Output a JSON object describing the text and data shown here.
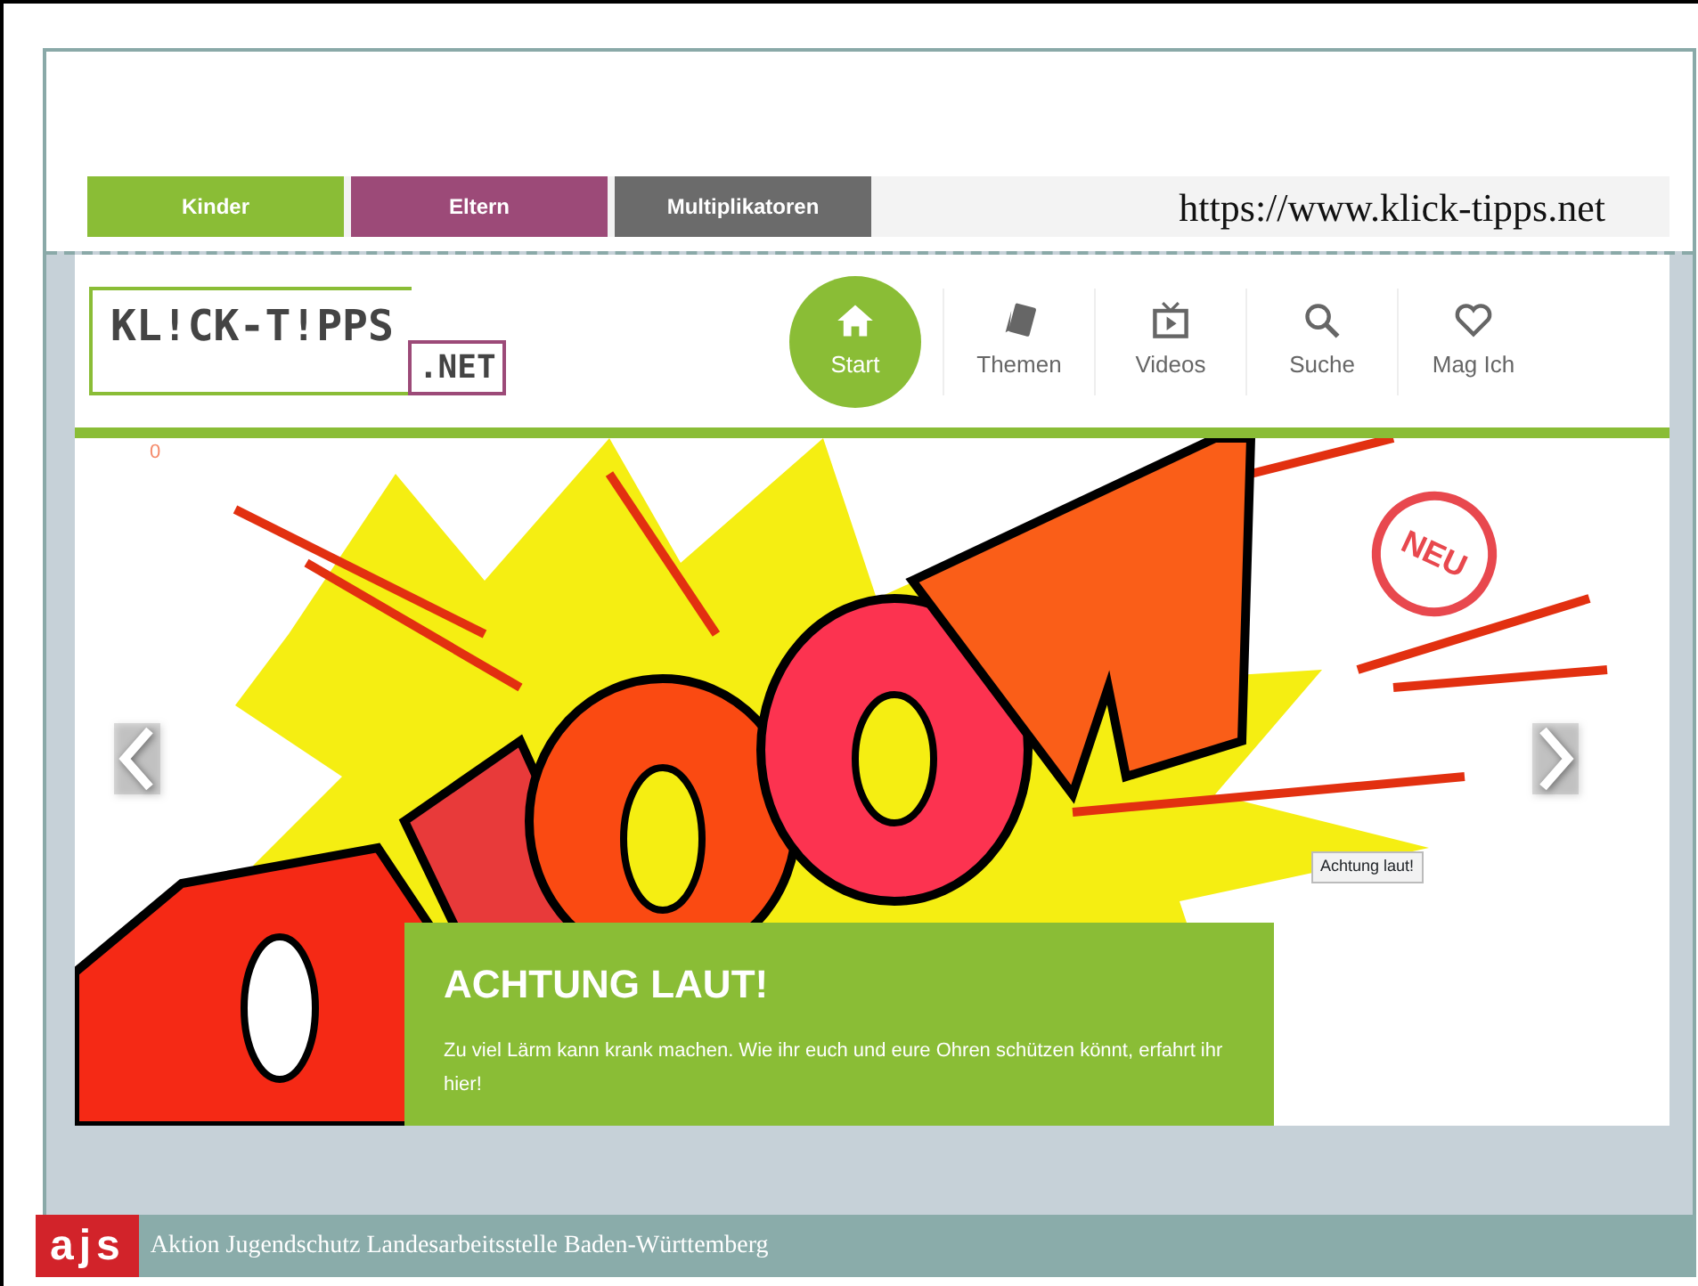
{
  "audience_tabs": [
    {
      "label": "Kinder",
      "color": "#8abd36"
    },
    {
      "label": "Eltern",
      "color": "#9c4a78"
    },
    {
      "label": "Multiplikatoren",
      "color": "#6b6b6b"
    }
  ],
  "url": "https://www.klick-tipps.net",
  "logo": {
    "main": "KL!CK-T!PPS",
    "suffix": ".NET"
  },
  "nav": [
    {
      "label": "Start",
      "kind": "home",
      "selected": true
    },
    {
      "label": "Themen",
      "kind": "cards",
      "selected": false
    },
    {
      "label": "Videos",
      "kind": "tv",
      "selected": false
    },
    {
      "label": "Suche",
      "kind": "search",
      "selected": false
    },
    {
      "label": "Mag Ich",
      "kind": "heart",
      "selected": false
    }
  ],
  "hero": {
    "marker": "0",
    "badge": "NEU",
    "tooltip": "Achtung laut!",
    "title": "ACHTUNG LAUT!",
    "text": "Zu viel Lärm kann krank machen. Wie ihr euch und eure Ohren schützen könnt, erfahrt ihr hier!"
  },
  "footer": {
    "logo": "ajs",
    "text": "Aktion Jugendschutz Landesarbeitsstelle Baden-Württemberg"
  }
}
